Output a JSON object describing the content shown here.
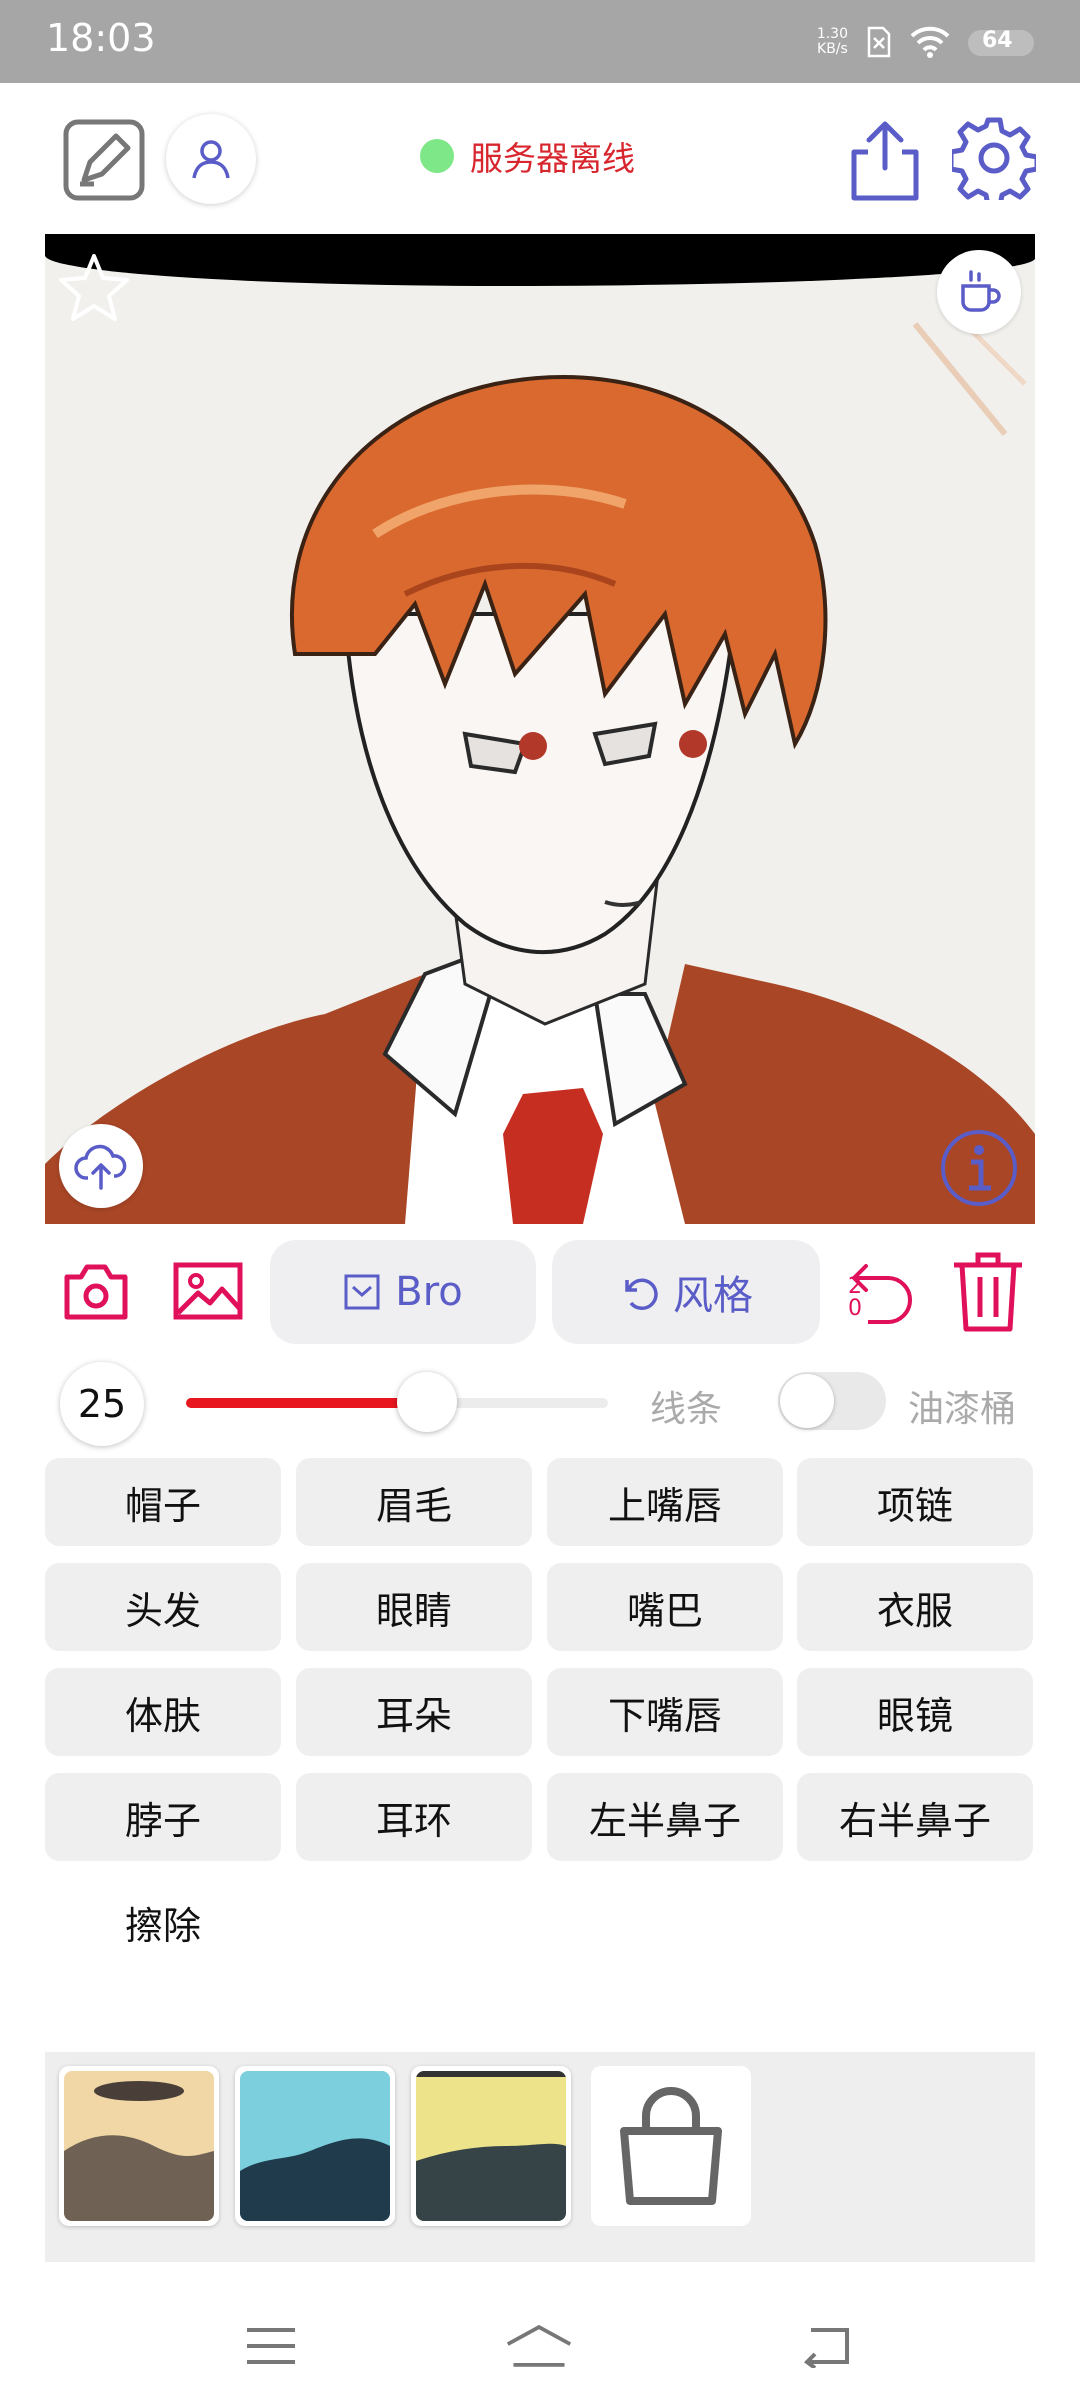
{
  "status_bar": {
    "time": "18:03",
    "net_speed_value": "1.30",
    "net_speed_unit": "KB/s",
    "battery": "64"
  },
  "header": {
    "server_status": "服务器离线",
    "status_color": "#7ee787"
  },
  "actions": {
    "bro_label": "Bro",
    "style_label": "风格",
    "undo_count": "20"
  },
  "brush": {
    "size": "25",
    "slider_fraction": 0.57,
    "lines_label": "线条",
    "paint_bucket_label": "油漆桶",
    "paint_bucket_enabled": false
  },
  "parts": [
    "帽子",
    "眉毛",
    "上嘴唇",
    "项链",
    "头发",
    "眼睛",
    "嘴巴",
    "衣服",
    "体肤",
    "耳朵",
    "下嘴唇",
    "眼镜",
    "脖子",
    "耳环",
    "左半鼻子",
    "右半鼻子",
    "擦除"
  ],
  "colors": {
    "accent": "#5a5cc7",
    "danger": "#e0105a",
    "slider": "#e8161e"
  }
}
